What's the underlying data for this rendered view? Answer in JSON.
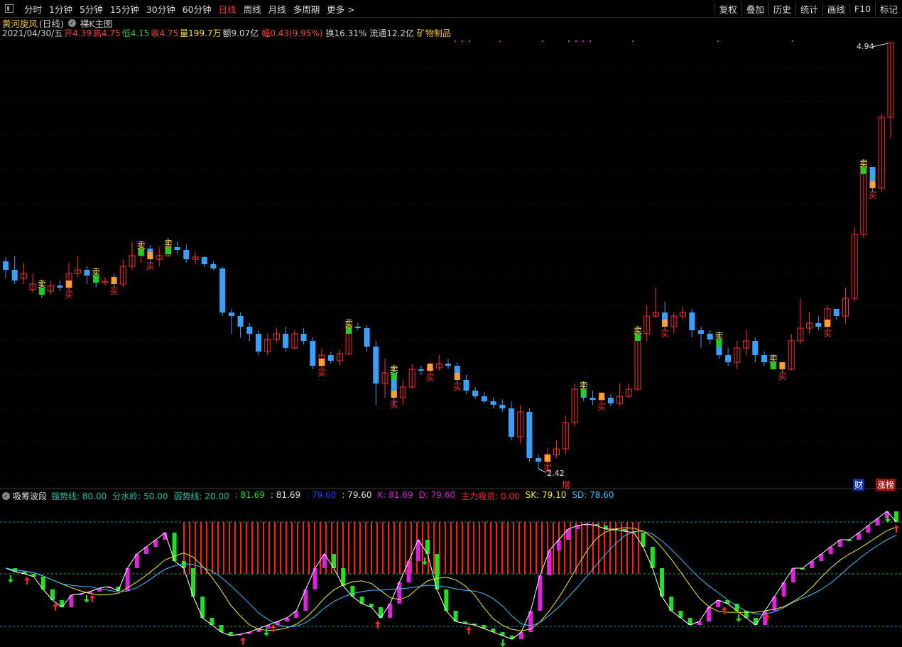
{
  "toolbar": {
    "periods": [
      "分时",
      "1分钟",
      "5分钟",
      "15分钟",
      "30分钟",
      "60分钟",
      "日线",
      "周线",
      "月线",
      "多周期",
      "更多 >"
    ],
    "active_period": "日线",
    "tools": [
      "复权",
      "叠加",
      "历史",
      "统计",
      "画线",
      "F10",
      "标记"
    ]
  },
  "stock": {
    "name": "黄河旋风",
    "period_label": "(日线)",
    "chart_mode": "裸K主图",
    "date": "2021/04/30/五",
    "open_label": "开",
    "open": "4.39",
    "high_label": "高",
    "high": "4.75",
    "low_label": "低",
    "low": "4.15",
    "close_label": "收",
    "close": "4.75",
    "volume_label": "量",
    "volume": "199.7万",
    "amount_label": "额",
    "amount": "9.07亿",
    "change_label": "幅",
    "change": "0.43(9.95%)",
    "turnover_label": "换",
    "turnover": "16.31%",
    "float_label": "流通",
    "float": "12.2亿",
    "sector": "矿物制品"
  },
  "price_labels": {
    "high": "4.94",
    "low": "2.42"
  },
  "signals": {
    "sell": "卖",
    "buy": "买"
  },
  "bottom_tags": {
    "zeng": "增",
    "cai": "财",
    "zhangbang": "涨榜"
  },
  "indicator": {
    "name": "吸筹波段",
    "items": [
      {
        "label": "强势线: 80.00",
        "color": "#20c0a0"
      },
      {
        "label": "分水岭: 50.00",
        "color": "#20c0a0"
      },
      {
        "label": "弱势线: 20.00",
        "color": "#20c0a0"
      },
      {
        "label": ": 81.69",
        "color": "#20e020"
      },
      {
        "label": ": 81.69",
        "color": "#e0e0e0"
      },
      {
        "label": ": 79.60",
        "color": "#2040ff"
      },
      {
        "label": ": 79.60",
        "color": "#e0e0e0"
      },
      {
        "label": "K: 81.69",
        "color": "#e020e0"
      },
      {
        "label": "D: 79.60",
        "color": "#e020e0"
      },
      {
        "label": "主力吸货: 0.00",
        "color": "#ff2020"
      },
      {
        "label": "SK: 79.10",
        "color": "#f0f020"
      },
      {
        "label": "SD: 78.60",
        "color": "#40c0ff"
      }
    ]
  },
  "colors": {
    "up": "#ff3030",
    "down": "#3aa0ff",
    "flat": "#60e0ff",
    "sell_box": "#20d020",
    "buy_box": "#ffa030",
    "sell_text": "#f0e040",
    "buy_text": "#ff3030"
  }
}
